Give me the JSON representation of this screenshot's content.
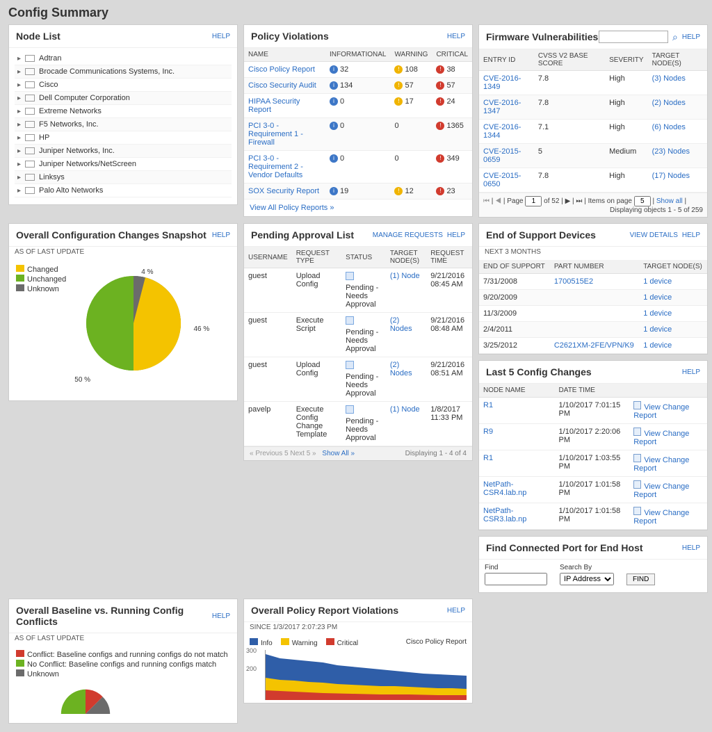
{
  "page_title": "Config Summary",
  "help_label": "HELP",
  "node_list": {
    "title": "Node List",
    "items": [
      "Adtran",
      "Brocade Communications Systems, Inc.",
      "Cisco",
      "Dell Computer Corporation",
      "Extreme Networks",
      "F5 Networks, Inc.",
      "HP",
      "Juniper Networks, Inc.",
      "Juniper Networks/NetScreen",
      "Linksys",
      "Palo Alto Networks"
    ]
  },
  "policy_violations": {
    "title": "Policy Violations",
    "cols": [
      "NAME",
      "INFORMATIONAL",
      "WARNING",
      "CRITICAL"
    ],
    "rows": [
      {
        "name": "Cisco Policy Report",
        "info": "32",
        "warn": "108",
        "crit": "38"
      },
      {
        "name": "Cisco Security Audit",
        "info": "134",
        "warn": "57",
        "crit": "57"
      },
      {
        "name": "HIPAA Security Report",
        "info": "0",
        "warn": "17",
        "crit": "24"
      },
      {
        "name": "PCI 3-0 - Requirement 1 - Firewall",
        "info": "0",
        "warn": "0",
        "crit": "1365"
      },
      {
        "name": "PCI 3-0 - Requirement 2 - Vendor Defaults",
        "info": "0",
        "warn": "0",
        "crit": "349"
      },
      {
        "name": "SOX Security Report",
        "info": "19",
        "warn": "12",
        "crit": "23"
      }
    ],
    "view_all": "View All Policy Reports »"
  },
  "firmware": {
    "title": "Firmware Vulnerabilities",
    "cols": [
      "ENTRY ID",
      "CVSS V2 BASE SCORE",
      "SEVERITY",
      "Target Node(s)"
    ],
    "rows": [
      {
        "id": "CVE-2016-1349",
        "score": "7.8",
        "sev": "High",
        "nodes": "(3) Nodes"
      },
      {
        "id": "CVE-2016-1347",
        "score": "7.8",
        "sev": "High",
        "nodes": "(2) Nodes"
      },
      {
        "id": "CVE-2016-1344",
        "score": "7.1",
        "sev": "High",
        "nodes": "(6) Nodes"
      },
      {
        "id": "CVE-2015-0659",
        "score": "5",
        "sev": "Medium",
        "nodes": "(23) Nodes"
      },
      {
        "id": "CVE-2015-0650",
        "score": "7.8",
        "sev": "High",
        "nodes": "(17) Nodes"
      }
    ],
    "pager": {
      "page": "1",
      "of": "of 52",
      "items_label": "Items on page",
      "items_val": "5",
      "show_all": "Show all",
      "displaying": "Displaying objects 1 - 5 of 259",
      "page_label": "Page"
    }
  },
  "config_changes": {
    "title": "Overall Configuration Changes Snapshot",
    "sub": "AS OF LAST UPDATE",
    "legend": {
      "changed": "Changed",
      "unchanged": "Unchanged",
      "unknown": "Unknown"
    },
    "labels": {
      "pct4": "4 %",
      "pct46": "46 %",
      "pct50": "50 %"
    }
  },
  "chart_data": [
    {
      "type": "pie",
      "title": "Overall Configuration Changes Snapshot",
      "series": [
        {
          "name": "Changed",
          "value": 46,
          "color": "#f4c300"
        },
        {
          "name": "Unchanged",
          "value": 50,
          "color": "#6cb221"
        },
        {
          "name": "Unknown",
          "value": 4,
          "color": "#6b6b6b"
        }
      ]
    },
    {
      "type": "area",
      "title": "Cisco Policy Report",
      "subtitle": "Overall Policy Report Violations since 1/3/2017 2:07:23 PM",
      "x": [
        1,
        2,
        3,
        4,
        5,
        6,
        7,
        8,
        9,
        10,
        11,
        12,
        13,
        14
      ],
      "series": [
        {
          "name": "Critical",
          "color": "#d13b2e",
          "values": [
            60,
            50,
            48,
            45,
            42,
            40,
            38,
            36,
            35,
            34,
            33,
            32,
            31,
            30
          ]
        },
        {
          "name": "Warning",
          "color": "#f4c300",
          "values": [
            130,
            120,
            115,
            110,
            105,
            100,
            95,
            92,
            90,
            88,
            85,
            82,
            80,
            78
          ]
        },
        {
          "name": "Info",
          "color": "#2f5ea8",
          "values": [
            280,
            260,
            250,
            240,
            232,
            225,
            220,
            214,
            210,
            205,
            200,
            195,
            192,
            190
          ]
        }
      ],
      "ylabel": "",
      "ylim": [
        0,
        300
      ],
      "yticks": [
        200,
        300
      ]
    }
  ],
  "pending": {
    "title": "Pending Approval List",
    "manage": "MANAGE REQUESTS",
    "cols": [
      "USERNAME",
      "REQUEST TYPE",
      "STATUS",
      "Target Node(s)",
      "REQUEST TIME"
    ],
    "rows": [
      {
        "u": "guest",
        "t": "Upload Config",
        "s": "Pending - Needs Approval",
        "n": "(1) Node",
        "r": "9/21/2016 08:45 AM"
      },
      {
        "u": "guest",
        "t": "Execute Script",
        "s": "Pending - Needs Approval",
        "n": "(2) Nodes",
        "r": "9/21/2016 08:48 AM"
      },
      {
        "u": "guest",
        "t": "Upload Config",
        "s": "Pending - Needs Approval",
        "n": "(2) Nodes",
        "r": "9/21/2016 08:51 AM"
      },
      {
        "u": "pavelp",
        "t": "Execute Config Change Template",
        "s": "Pending - Needs Approval",
        "n": "(1) Node",
        "r": "1/8/2017 11:33 PM"
      }
    ],
    "footer": {
      "prev": "« Previous 5",
      "next": "Next 5 »",
      "show_all": "Show All »",
      "disp": "Displaying 1 - 4 of 4"
    }
  },
  "eos": {
    "title": "End of Support Devices",
    "sub": "NEXT 3 MONTHS",
    "view": "VIEW DETAILS",
    "cols": [
      "End of Support",
      "Part Number",
      "Target Node(s)"
    ],
    "rows": [
      {
        "d": "7/31/2008",
        "p": "1700515E2",
        "n": "1 device"
      },
      {
        "d": "9/20/2009",
        "p": "",
        "n": "1 device"
      },
      {
        "d": "11/3/2009",
        "p": "",
        "n": "1 device"
      },
      {
        "d": "2/4/2011",
        "p": "",
        "n": "1 device"
      },
      {
        "d": "3/25/2012",
        "p": "C2621XM-2FE/VPN/K9",
        "n": "1 device"
      }
    ]
  },
  "last5": {
    "title": "Last 5 Config Changes",
    "cols": [
      "NODE NAME",
      "DATE TIME",
      ""
    ],
    "view_label": "View Change Report",
    "rows": [
      {
        "n": "R1",
        "d": "1/10/2017 7:01:15 PM"
      },
      {
        "n": "R9",
        "d": "1/10/2017 2:20:06 PM"
      },
      {
        "n": "R1",
        "d": "1/10/2017 1:03:55 PM"
      },
      {
        "n": "NetPath-CSR4.lab.np",
        "d": "1/10/2017 1:01:58 PM"
      },
      {
        "n": "NetPath-CSR3.lab.np",
        "d": "1/10/2017 1:01:58 PM"
      }
    ]
  },
  "baseline": {
    "title": "Overall Baseline vs. Running Config Conflicts",
    "sub": "AS OF LAST UPDATE",
    "legend": {
      "conflict": "Conflict: Baseline configs and running configs do not match",
      "noconflict": "No Conflict: Baseline configs and running configs match",
      "unknown": "Unknown"
    }
  },
  "violations_chart": {
    "title": "Overall Policy Report Violations",
    "since": "SINCE 1/3/2017 2:07:23 PM",
    "legend": {
      "info": "Info",
      "warning": "Warning",
      "critical": "Critical"
    },
    "chart_title": "Cisco Policy Report",
    "y300": "300",
    "y200": "200"
  },
  "find_port": {
    "title": "Find Connected Port for End Host",
    "find_label": "Find",
    "search_by_label": "Search By",
    "option": "IP Address",
    "btn": "FIND"
  }
}
